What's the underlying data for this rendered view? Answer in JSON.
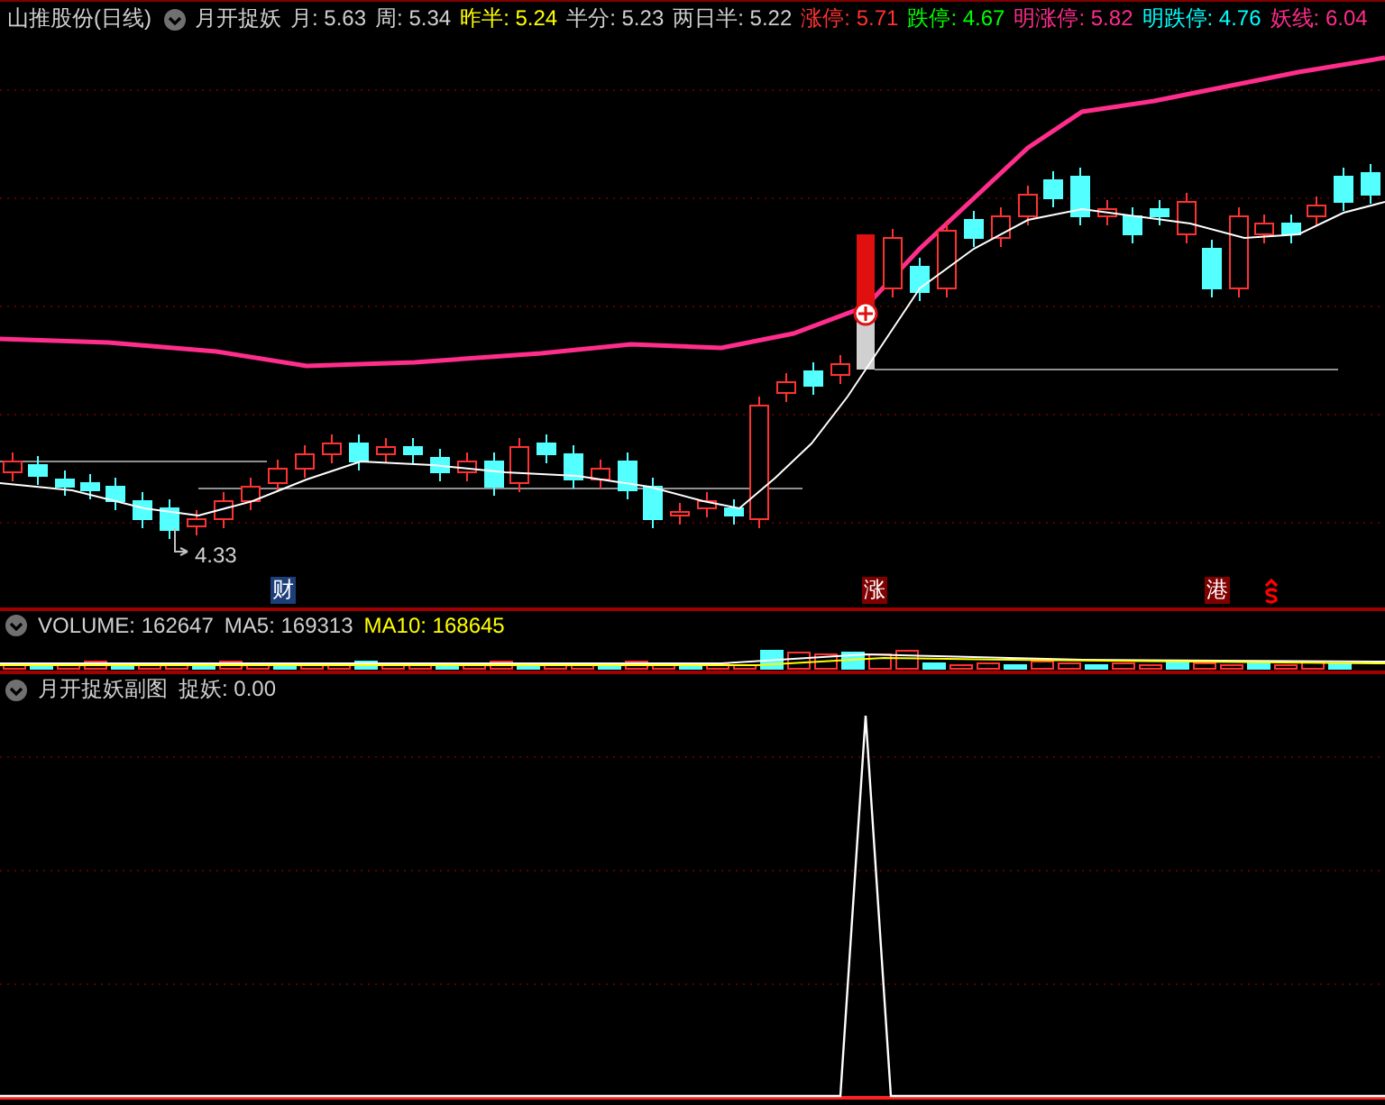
{
  "header": {
    "stock": "山推股份(日线)",
    "indicator": "月开捉妖",
    "values": [
      {
        "text": "月: 5.63",
        "color": "#d0d0d0"
      },
      {
        "text": "周: 5.34",
        "color": "#d0d0d0"
      },
      {
        "text": "昨半: 5.24",
        "color": "#ffff00"
      },
      {
        "text": "半分: 5.23",
        "color": "#d0d0d0"
      },
      {
        "text": "两日半: 5.22",
        "color": "#d0d0d0"
      },
      {
        "text": "涨停: 5.71",
        "color": "#ff3232"
      },
      {
        "text": "跌停: 4.67",
        "color": "#00ff00"
      },
      {
        "text": "明涨停: 5.82",
        "color": "#ff2d8c"
      },
      {
        "text": "明跌停: 4.76",
        "color": "#00ffff"
      },
      {
        "text": "妖线: 6.04",
        "color": "#ff2d8c"
      }
    ]
  },
  "main_chart": {
    "low_label": "4.33",
    "markers": [
      {
        "kind": "text",
        "text": "财",
        "color": "#1c3f7a"
      },
      {
        "kind": "text",
        "text": "涨",
        "color": "#800000"
      },
      {
        "kind": "text",
        "text": "港",
        "color": "#800000"
      },
      {
        "kind": "icon",
        "color": "#ff0000"
      }
    ]
  },
  "volume": {
    "values": [
      {
        "text": "VOLUME: 162647",
        "color": "#d0d0d0"
      },
      {
        "text": "MA5: 169313",
        "color": "#d0d0d0"
      },
      {
        "text": "MA10: 168645",
        "color": "#ffff00"
      }
    ]
  },
  "sub_chart": {
    "title": "月开捉妖副图",
    "value": "捉妖: 0.00"
  }
}
